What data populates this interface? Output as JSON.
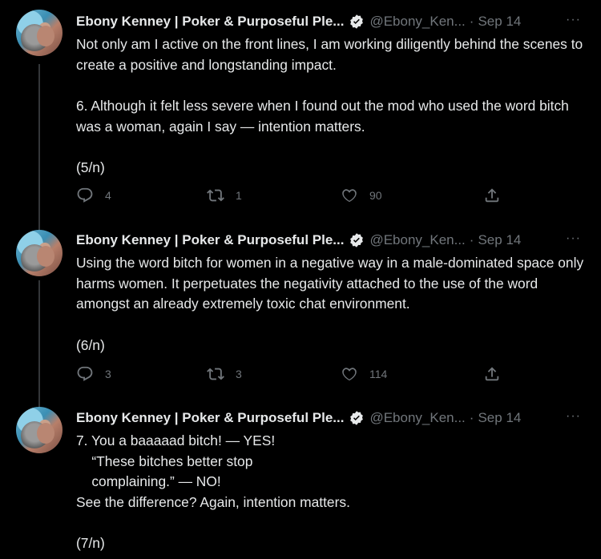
{
  "tweets": [
    {
      "author_name": "Ebony Kenney | Poker & Purposeful Ple...",
      "handle": "@Ebony_Ken...",
      "separator": "·",
      "date": "Sep 14",
      "more": "···",
      "paragraphs": [
        "Not only am I active on the front lines, I am working diligently behind the scenes to create a positive and longstanding impact.",
        "6. Although it felt less severe when I found out the mod who used the word bitch was a woman, again I say — intention matters.",
        "(5/n)"
      ],
      "replies": "4",
      "retweets": "1",
      "likes": "90"
    },
    {
      "author_name": "Ebony Kenney | Poker & Purposeful Ple...",
      "handle": "@Ebony_Ken...",
      "separator": "·",
      "date": "Sep 14",
      "more": "···",
      "paragraphs": [
        "Using the word bitch for women in a negative way in a male-dominated space only harms women. It perpetuates the negativity attached to the use of the word amongst an already extremely toxic chat environment.",
        "(6/n)"
      ],
      "replies": "3",
      "retweets": "3",
      "likes": "114"
    },
    {
      "author_name": "Ebony Kenney | Poker & Purposeful Ple...",
      "handle": "@Ebony_Ken...",
      "separator": "·",
      "date": "Sep 14",
      "more": "···",
      "paragraphs": [
        "7. You a baaaaad bitch! — YES!\n    “These bitches better stop\n    complaining.” — NO!\nSee the difference? Again, intention matters.",
        "(7/n)"
      ]
    }
  ],
  "colors": {
    "background": "#000000",
    "text": "#e7e9ea",
    "secondary": "#71767b",
    "thread_line": "#333639",
    "verified_badge": "#e7e9ea"
  },
  "icons": [
    "reply-icon",
    "retweet-icon",
    "like-icon",
    "share-icon",
    "verified-icon",
    "more-icon"
  ]
}
